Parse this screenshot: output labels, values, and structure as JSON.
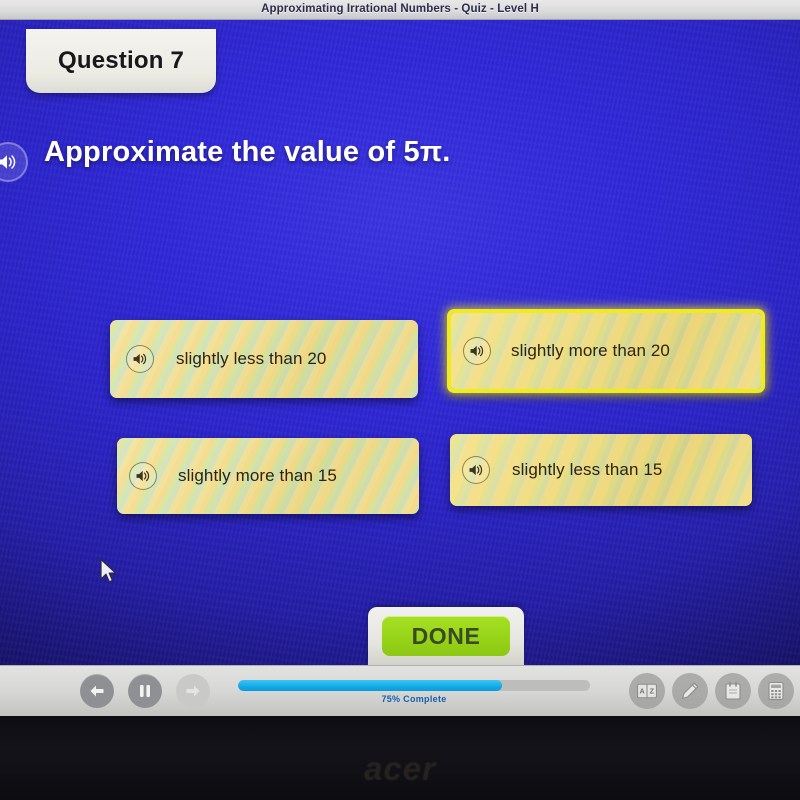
{
  "chrome": {
    "title": "Approximating Irrational Numbers - Quiz - Level H"
  },
  "question_tab": {
    "label": "Question 7"
  },
  "prompt": {
    "text": "Approximate the value of 5π.",
    "speaker_icon": "speaker-icon"
  },
  "answers": [
    {
      "id": "a",
      "label": "slightly less than 20",
      "selected": false,
      "speaker_icon": "speaker-icon"
    },
    {
      "id": "b",
      "label": "slightly more than 20",
      "selected": true,
      "speaker_icon": "speaker-icon"
    },
    {
      "id": "c",
      "label": "slightly more than 15",
      "selected": false,
      "speaker_icon": "speaker-icon"
    },
    {
      "id": "d",
      "label": "slightly less than 15",
      "selected": false,
      "speaker_icon": "speaker-icon"
    }
  ],
  "done": {
    "label": "DONE"
  },
  "toolbar": {
    "back_icon": "back-arrow-icon",
    "pause_icon": "pause-icon",
    "forward_icon": "forward-arrow-icon",
    "progress_percent": 75,
    "progress_label": "75% Complete",
    "tools": [
      {
        "id": "dictionary",
        "icon": "dictionary-icon",
        "letters_left": "A",
        "letters_right": "Z"
      },
      {
        "id": "highlighter",
        "icon": "pencil-icon"
      },
      {
        "id": "notepad",
        "icon": "notepad-icon"
      },
      {
        "id": "calculator",
        "icon": "calculator-icon"
      }
    ]
  },
  "bezel": {
    "brand": "acer"
  },
  "colors": {
    "stage_blue": "#2a22c4",
    "selected_outline": "#f1ea1c",
    "done_green": "#97d419",
    "progress_cyan": "#12a9e8",
    "card_cream": "#e9dc96"
  }
}
